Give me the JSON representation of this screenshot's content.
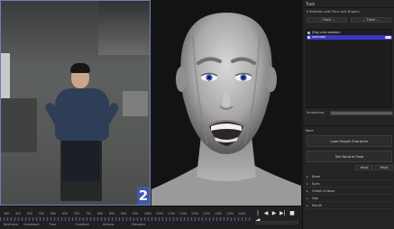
{
  "camera": {
    "badge": "2"
  },
  "panel": {
    "tab_title": "Track",
    "section_title": "Skeleton with Face and Fingers",
    "track_left": "-- Track --",
    "track_right": "-- Track --",
    "items": [
      {
        "label": "(Rig) new skeleton",
        "selected": false
      },
      {
        "label": "unknown",
        "selected": true
      }
    ],
    "smoothing_label": "Smoothing",
    "face_section": "Face",
    "load_target_button": "Load Target Character",
    "set_neutral_button": "Set Neutral Pose",
    "mini_buttons": [
      "Head translate",
      "Head rotation"
    ],
    "categories": [
      "Brow",
      "Eyes",
      "Cheek & Nose",
      "Lips",
      "Mouth"
    ]
  },
  "timeline": {
    "ticks": [
      "400",
      "450",
      "500",
      "550",
      "600",
      "650",
      "700",
      "750",
      "800",
      "850",
      "900",
      "950",
      "1000",
      "1050",
      "1100",
      "1150",
      "1200",
      "1250",
      "1300",
      "1350",
      "1400"
    ],
    "columns": [
      "Keyframe",
      "Command",
      "Time",
      "Duration",
      "Actions",
      "Filename"
    ],
    "transport": [
      "|◀",
      "◀",
      "▶",
      "▶|",
      "■"
    ]
  }
}
